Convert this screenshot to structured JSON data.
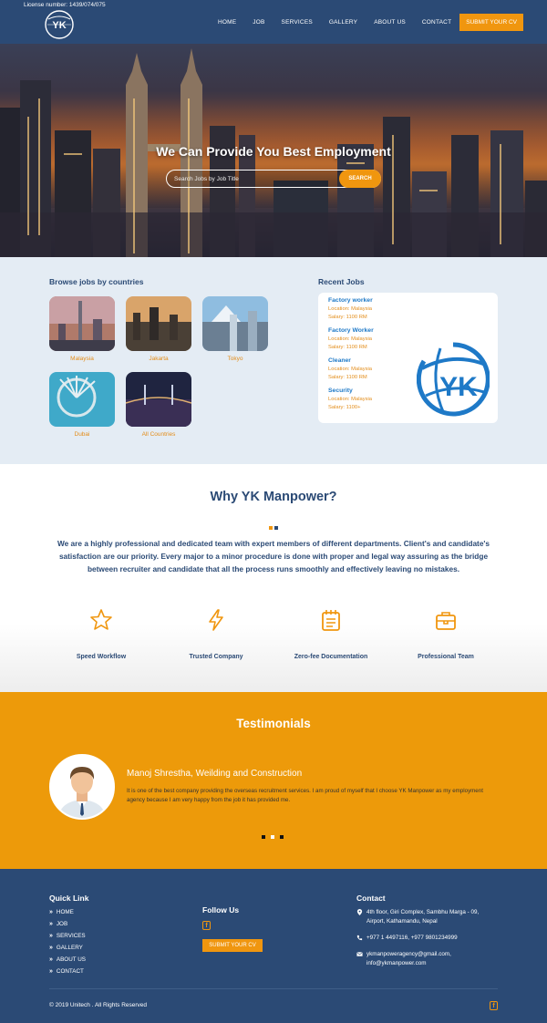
{
  "header": {
    "license": "License number: 1439/074/075",
    "logo_text": "YK",
    "nav": [
      "HOME",
      "JOB",
      "SERVICES",
      "GALLERY",
      "ABOUT US",
      "CONTACT"
    ],
    "cv_button": "SUBMIT YOUR CV"
  },
  "hero": {
    "title": "We Can Provide You Best Employment",
    "search_placeholder": "Search Jobs by Job Title",
    "search_button": "SEARCH"
  },
  "jobs": {
    "browse_heading": "Browse jobs by countries",
    "countries": [
      "Malaysia",
      "Jakarta",
      "Tokyo",
      "Dubai",
      "All Countries"
    ],
    "recent_heading": "Recent Jobs",
    "recent": [
      {
        "title": "Factory worker",
        "location": "Location: Malaysia",
        "salary": "Salary: 1100 RM"
      },
      {
        "title": "Factory Worker",
        "location": "Location: Malaysia",
        "salary": "Salary: 1100 RM"
      },
      {
        "title": "Cleaner",
        "location": "Location: Malaysia",
        "salary": "Salary: 1100 RM"
      },
      {
        "title": "Security",
        "location": "Location: Malaysia",
        "salary": "Salary: 1100+"
      }
    ],
    "logo_text": "YK"
  },
  "why": {
    "title": "Why YK Manpower?",
    "text": "We are a highly professional and dedicated team with expert members of different departments. Client's and candidate's satisfaction are our priority. Every major to a minor procedure is done with proper and legal way assuring as the bridge between recruiter and candidate that all the process runs smoothly and effectively leaving no mistakes.",
    "features": [
      {
        "label": "Speed Workflow",
        "icon": "star-icon"
      },
      {
        "label": "Trusted Company",
        "icon": "lightning-icon"
      },
      {
        "label": "Zero-fee Documentation",
        "icon": "notepad-icon"
      },
      {
        "label": "Professional Team",
        "icon": "briefcase-icon"
      }
    ]
  },
  "testimonials": {
    "title": "Testimonials",
    "name": "Manoj Shrestha, Weilding and Construction",
    "text": "It is one of the best company providing the overseas recruitment services. I am proud of myself that I choose YK Manpower as my employment agency because I am very happy from the job it has provided me."
  },
  "footer": {
    "quick_heading": "Quick Link",
    "links": [
      "HOME",
      "JOB",
      "SERVICES",
      "GALLERY",
      "ABOUT US",
      "CONTACT"
    ],
    "follow_heading": "Follow Us",
    "facebook_glyph": "f",
    "cv_button": "SUBMIT YOUR CV",
    "contact_heading": "Contact",
    "address_1": "4th floor, Giri Complex, Sambhu Marga - 09,",
    "address_2": "Airport, Kathamandu, Nepal",
    "phone": "+977 1 4497116, +977 9801234999",
    "email_1": "ykmanpoweragency@gmail.com,",
    "email_2": "info@ykmanpower.com",
    "copyright": "© 2019 Unitech . All Rights Reserved"
  },
  "colors": {
    "navy": "#2b4a75",
    "orange": "#f0960f",
    "link_blue": "#1e79c7",
    "light_bg": "#e4ecf4"
  }
}
